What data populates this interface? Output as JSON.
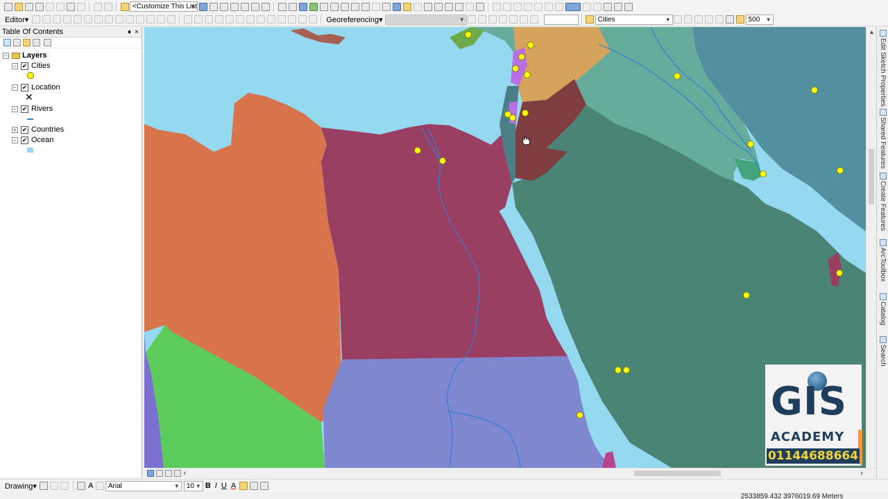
{
  "toolbar": {
    "customize_combo": "<Customize This List",
    "editor_label": "Editor",
    "editor_arrow": "▾",
    "georef_label": "Georeferencing",
    "georef_arrow": "▾",
    "layer_combo": "Cities",
    "scale_value": "500"
  },
  "toc": {
    "title": "Table Of Contents",
    "pin": "♦",
    "close": "×",
    "root_label": "Layers",
    "layers": [
      {
        "label": "Cities",
        "checked": "✔",
        "expander": "−"
      },
      {
        "label": "Location",
        "checked": "✔",
        "expander": "−"
      },
      {
        "label": "Rivers",
        "checked": "✔",
        "expander": "−"
      },
      {
        "label": "Countries",
        "checked": "✔",
        "expander": "+"
      },
      {
        "label": "Ocean",
        "checked": "✔",
        "expander": "−"
      }
    ]
  },
  "dock_tabs": [
    {
      "label": "Edit Sketch Properties"
    },
    {
      "label": "Shared Features"
    },
    {
      "label": "Create Features"
    },
    {
      "label": "ArcToolbox"
    },
    {
      "label": "Catalog"
    },
    {
      "label": "Search"
    }
  ],
  "drawbar": {
    "drawing_label": "Drawing",
    "drawing_arrow": "▾",
    "font_combo": "Arial",
    "size_combo": "10",
    "bold": "B",
    "italic": "I",
    "underline": "U",
    "text_color": "A"
  },
  "status": {
    "coords": "2533859.432  3976019.69 Meters"
  },
  "logo": {
    "line1": "GIS",
    "line2": "ACADEMY",
    "phone": "01144688664"
  },
  "colors": {
    "ocean": "#95d9f1",
    "libya": "#d7744c",
    "egypt": "#9a3f62",
    "sudan": "#8087d1",
    "chad": "#5ccc5a",
    "saudi": "#4b8374",
    "jordan": "#7e3d3f",
    "syria": "#d5a35c",
    "iraq": "#66ac9d",
    "iran": "#5290a0",
    "city": "#ffff00"
  }
}
